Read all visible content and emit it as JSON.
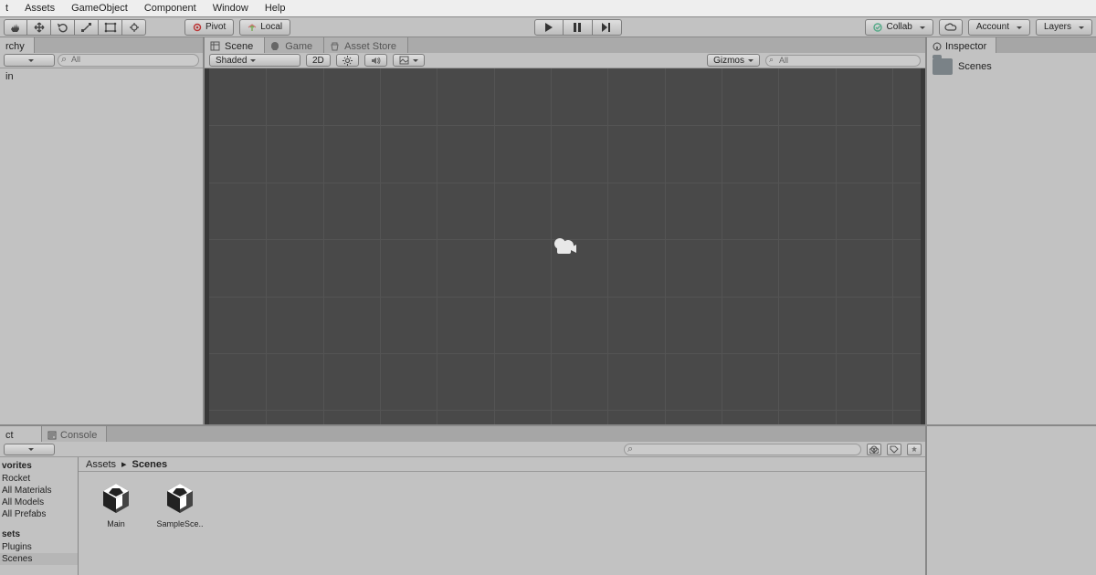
{
  "menubar": [
    "t",
    "Assets",
    "GameObject",
    "Component",
    "Window",
    "Help"
  ],
  "topbar": {
    "pivot_label": "Pivot",
    "local_label": "Local",
    "collab_label": "Collab",
    "account_label": "Account",
    "layers_label": "Layers"
  },
  "hierarchy": {
    "tab": "rchy",
    "search_placeholder": "All",
    "scene_item": "in"
  },
  "scene_panel": {
    "tabs": [
      "Scene",
      "Game",
      "Asset Store"
    ],
    "shading": "Shaded",
    "mode2d": "2D",
    "gizmos": "Gizmos",
    "search_placeholder": "All"
  },
  "inspector": {
    "tab": "Inspector",
    "folder": "Scenes"
  },
  "project": {
    "tabs": [
      "ct",
      "Console"
    ],
    "favorites_hdr": "vorites",
    "favorites": [
      "Rocket",
      "All Materials",
      "All Models",
      "All Prefabs"
    ],
    "assets_hdr": "sets",
    "assets_tree": [
      "Plugins",
      "Scenes"
    ],
    "breadcrumb": [
      "Assets",
      "Scenes"
    ],
    "assets": [
      {
        "name": "Main"
      },
      {
        "name": "SampleSce.."
      }
    ]
  }
}
